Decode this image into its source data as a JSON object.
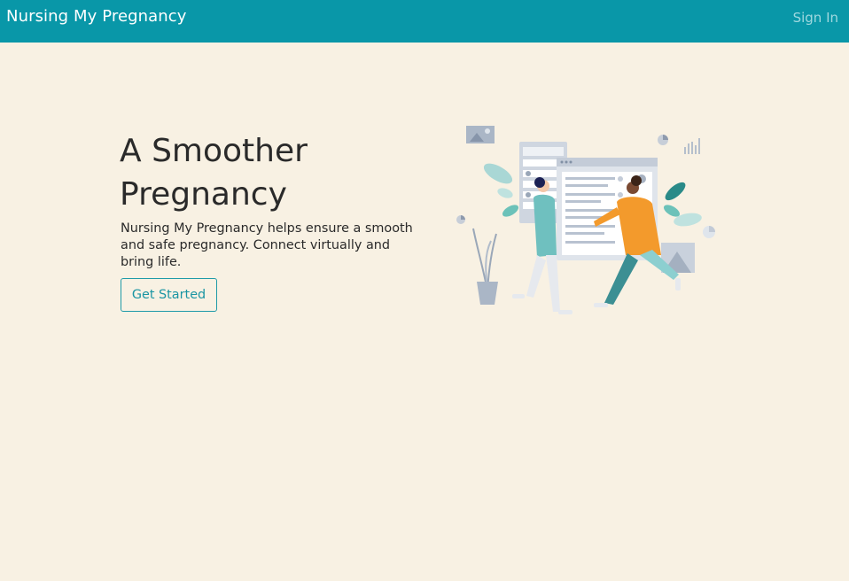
{
  "navbar": {
    "brand": "Nursing My Pregnancy",
    "signin_label": "Sign In"
  },
  "hero": {
    "title": "A Smoother Pregnancy",
    "description": "Nursing My Pregnancy helps ensure a smooth and safe pregnancy. Connect virtually and bring life.",
    "cta_label": "Get Started"
  },
  "colors": {
    "navbar_bg": "#0997a8",
    "page_bg": "#f8f1e3",
    "accent": "#1a95a3",
    "text": "#2a2a2a"
  },
  "illustration": {
    "icon": "two-women-dashboard-illustration"
  }
}
